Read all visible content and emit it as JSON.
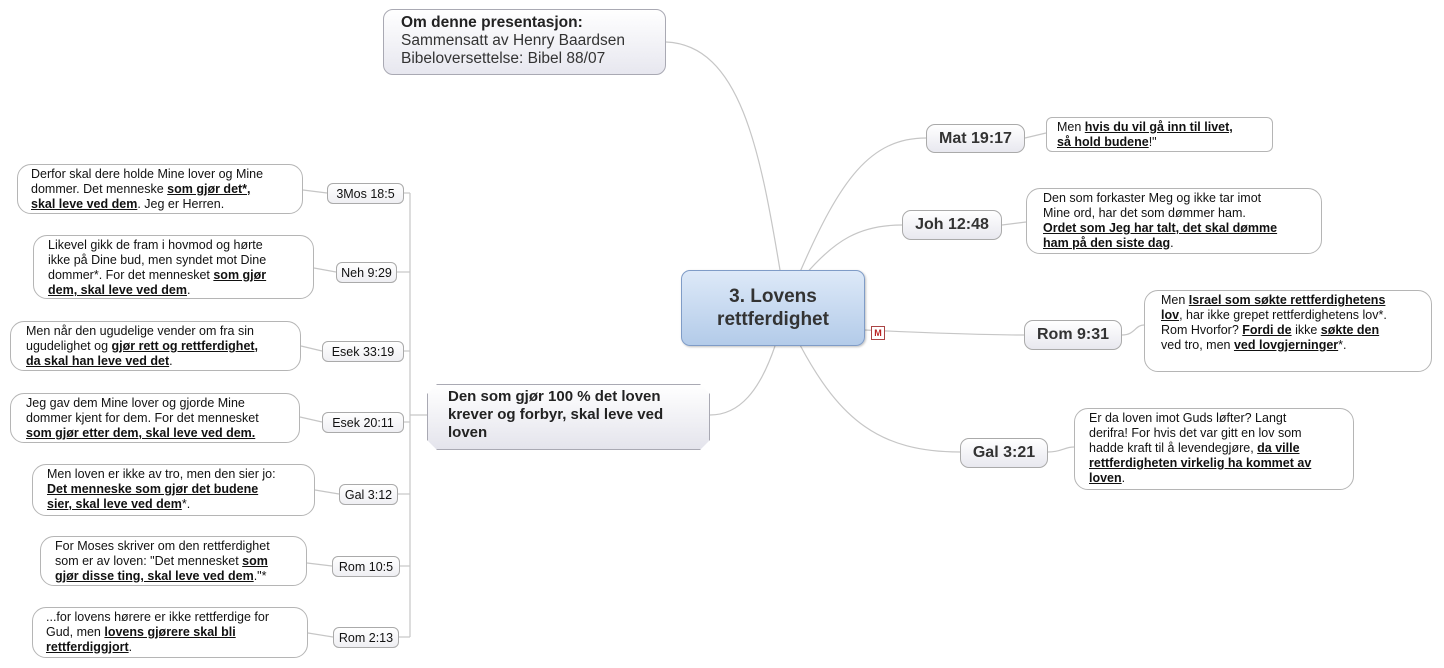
{
  "central": {
    "line1": "3. Lovens",
    "line2": "rettferdighet"
  },
  "info": {
    "title": "Om denne presentasjon:",
    "line1": "Sammensatt av Henry Baardsen",
    "line2": "Bibeloversettelse: Bibel 88/07"
  },
  "left_topic": {
    "line1": "Den som gjør 100 % det loven",
    "line2": "krever og forbyr, skal leve ved",
    "line3": "loven"
  },
  "right": {
    "mat": {
      "ref": "Mat 19:17",
      "t1": "Men ",
      "b1": "hvis du vil gå inn til livet,",
      "b2": "så hold budene",
      "t2": "!\""
    },
    "joh": {
      "ref": "Joh 12:48",
      "t1": "Den som forkaster Meg og ikke tar imot",
      "t2": "Mine ord, har det som dømmer ham.",
      "b1": "Ordet som Jeg har talt, det skal dømme",
      "b2": "ham på den siste dag",
      "t3": "."
    },
    "rom931": {
      "ref": "Rom 9:31",
      "t1": "Men ",
      "b1": "Israel som søkte rettferdighetens",
      "b2": "lov",
      "t2": ", har ikke grepet rettferdighetens lov*.",
      "t3": "Rom Hvorfor? ",
      "b3": "Fordi de",
      "t4": " ikke ",
      "b4": "søkte den",
      "t5": "ved tro, men ",
      "b5": "ved lovgjerninger",
      "t6": "*."
    },
    "gal321": {
      "ref": "Gal 3:21",
      "t1": "Er da loven imot Guds løfter? Langt",
      "t2": "derifra! For hvis det var gitt en lov som",
      "t3": "hadde kraft til å levendegjøre, ",
      "b1": "da ville",
      "b2": "rettferdigheten virkelig ha kommet av",
      "b3": "loven",
      "t4": "."
    }
  },
  "left": {
    "mos": {
      "ref": "3Mos 18:5",
      "t1": "Derfor skal dere holde Mine lover og Mine",
      "t2": "dommer. Det menneske ",
      "b1": "som gjør det*,",
      "b2": "skal leve ved dem",
      "t3": ". Jeg er Herren."
    },
    "neh": {
      "ref": "Neh 9:29",
      "t1": " Likevel gikk de fram i hovmod og hørte",
      "t2": "ikke på Dine bud, men syndet mot Dine",
      "t3": "dommer*. For det mennesket ",
      "b1": "som gjør",
      "b2": "dem, skal leve ved dem",
      "t4": "."
    },
    "esek3319": {
      "ref": "Esek 33:19",
      "t1": "Men når den ugudelige vender om fra sin",
      "t2": "ugudelighet og ",
      "b1": "gjør rett og rettferdighet,",
      "b2": "da skal han leve ved det",
      "t3": "."
    },
    "esek2011": {
      "ref": "Esek 20:11",
      "t1": "Jeg gav dem Mine lover og gjorde Mine",
      "t2": "dommer kjent for dem. For det mennesket",
      "b1": "som gjør etter dem, skal leve ved dem."
    },
    "gal312": {
      "ref": "Gal 3:12",
      "t1": "Men loven er ikke av tro, men den sier jo:",
      "b1": "Det menneske som gjør det budene",
      "b2": "sier, skal leve ved dem",
      "t2": "*."
    },
    "rom105": {
      "ref": "Rom 10:5",
      "t1": "For Moses skriver om den rettferdighet",
      "t2": "som er av loven: \"Det mennesket ",
      "b1": "som",
      "b2": "gjør disse ting, skal leve ved dem",
      "t3": ".\"*"
    },
    "rom213": {
      "ref": "Rom 2:13",
      "t1": "...for lovens hørere er ikke rettferdige for",
      "t2": "Gud, men ",
      "b1": "lovens gjørere skal bli",
      "b2": "rettferdiggjort",
      "t3": "."
    }
  },
  "colors": {
    "line": "#c4c4c4",
    "central_top": "#dde9f8",
    "central_bottom": "#b3cbe9"
  }
}
